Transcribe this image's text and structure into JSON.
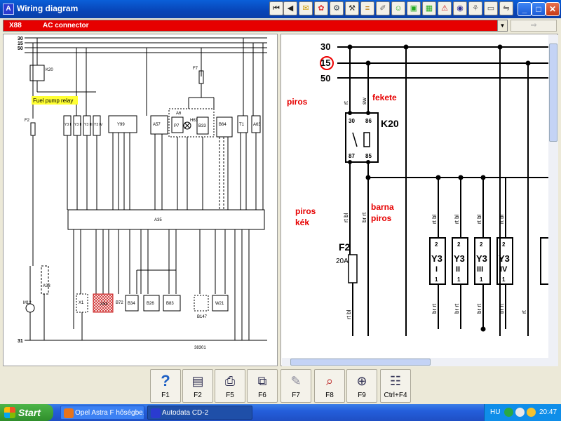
{
  "window": {
    "title": "Wiring diagram",
    "app_icon": "A"
  },
  "toolbar": {
    "buttons": [
      "first-page",
      "prev-page",
      "tool-1",
      "tool-2",
      "tool-3",
      "tool-4",
      "tool-5",
      "tool-6",
      "tool-7",
      "tool-8",
      "tool-9",
      "tool-10",
      "tool-11",
      "tool-12",
      "tool-13",
      "tool-14"
    ]
  },
  "window_controls": {
    "minimize": "_",
    "maximize": "□",
    "close": "✕"
  },
  "connector": {
    "code": "X88",
    "name": "AC connector",
    "go_icon": "⇒"
  },
  "left_diagram": {
    "rail_labels": [
      "30",
      "15",
      "50",
      "31"
    ],
    "highlight_label": "Fuel pump relay",
    "component_labels": [
      "K20",
      "F2",
      "F7",
      "A6",
      "H63",
      "P7",
      "B33",
      "B64",
      "A57",
      "Y99",
      "A35",
      "X1",
      "B72",
      "B34",
      "B26",
      "B83",
      "B147",
      "W21",
      "M12",
      "A33",
      "A54",
      "A63",
      "T1"
    ],
    "relay_labels": [
      "Y3 I",
      "Y3 II",
      "Y3 III",
      "Y3 IV"
    ],
    "footer_code": "38301"
  },
  "right_diagram": {
    "rails": [
      "30",
      "15",
      "50"
    ],
    "relay": {
      "name": "K20",
      "pins_top": [
        "30",
        "86"
      ],
      "pins_bottom": [
        "87",
        "85"
      ]
    },
    "wire_top": [
      "rt",
      "sw"
    ],
    "color_notes": [
      "piros",
      "fekete",
      "piros",
      "kék",
      "barna",
      "piros"
    ],
    "fuse": {
      "name": "F2",
      "rating": "20A"
    },
    "wire_codes": [
      "rt bl",
      "br rt",
      "rt bl",
      "rt bl",
      "rt bl",
      "rt bl",
      "rt bl",
      "br rt",
      "br rt",
      "br rt",
      "br rt",
      "rt"
    ],
    "injectors": [
      {
        "name": "Y3",
        "cyl": "I",
        "pin_top": "2",
        "pin_bottom": "1"
      },
      {
        "name": "Y3",
        "cyl": "II",
        "pin_top": "2",
        "pin_bottom": "1"
      },
      {
        "name": "Y3",
        "cyl": "III",
        "pin_top": "2",
        "pin_bottom": "1"
      },
      {
        "name": "Y3",
        "cyl": "IV",
        "pin_top": "2",
        "pin_bottom": "1"
      }
    ]
  },
  "function_keys": [
    {
      "label": "F1",
      "icon": "help-icon",
      "glyph": "?"
    },
    {
      "label": "F2",
      "icon": "print-preview-icon",
      "glyph": "▤"
    },
    {
      "label": "F5",
      "icon": "printer-icon",
      "glyph": "⎙"
    },
    {
      "label": "F6",
      "icon": "connector-icon",
      "glyph": "⧉"
    },
    {
      "label": "F7",
      "icon": "pen-icon",
      "glyph": "✎"
    },
    {
      "label": "F8",
      "icon": "find-icon",
      "glyph": "⌕"
    },
    {
      "label": "F9",
      "icon": "zoom-icon",
      "glyph": "⊕"
    },
    {
      "label": "Ctrl+F4",
      "icon": "table-icon",
      "glyph": "☷"
    }
  ],
  "taskbar": {
    "start": "Start",
    "tasks": [
      "Opel Astra F hőségbe...",
      "Autodata CD-2"
    ],
    "lang": "HU",
    "time": "20:47"
  },
  "colors": {
    "accent_red": "#e60000",
    "title_blue": "#0a5fd8",
    "relay_highlight": "#ffff33"
  }
}
